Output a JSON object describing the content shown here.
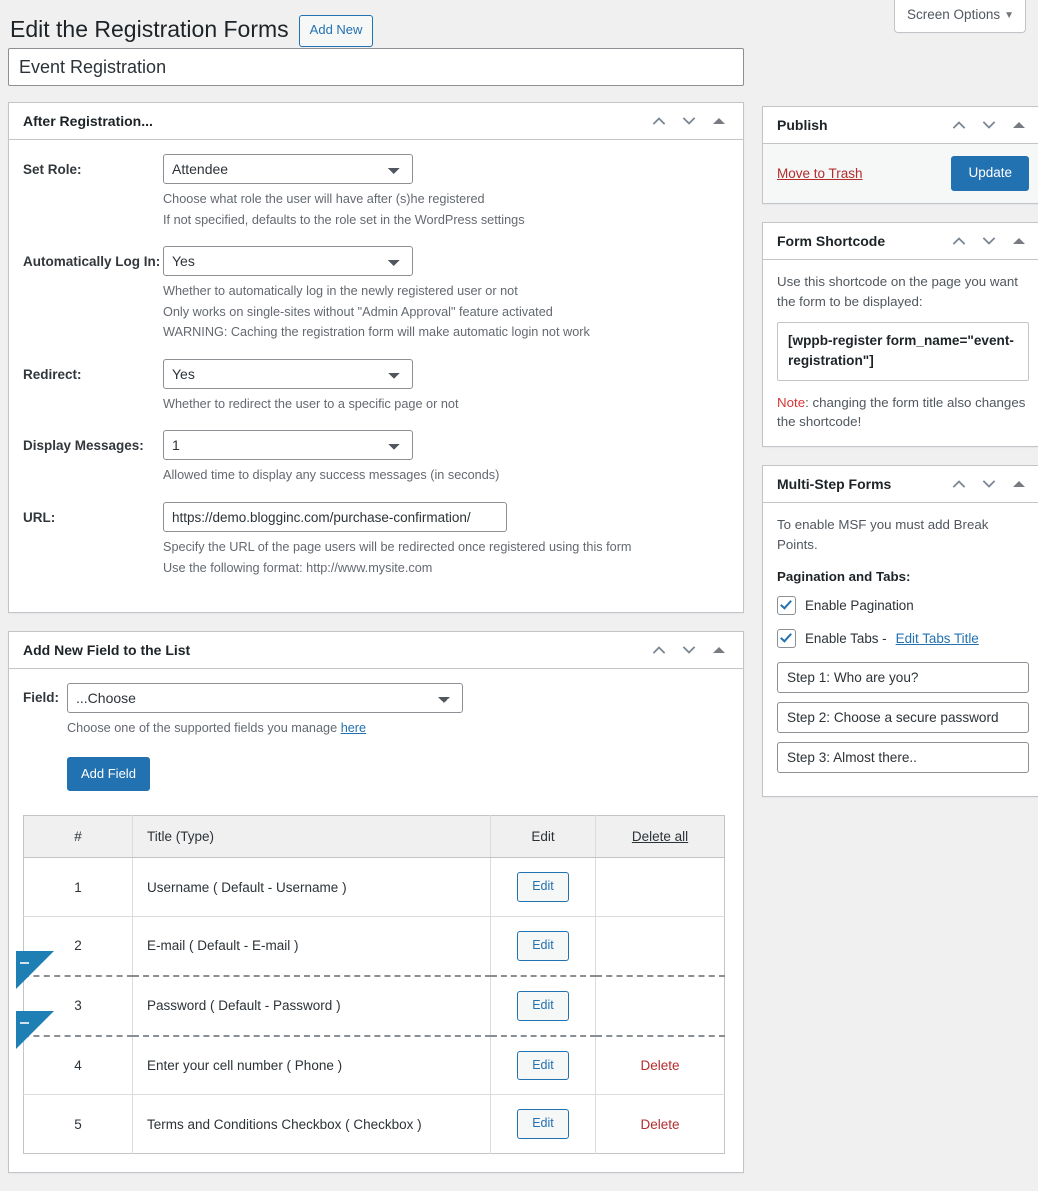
{
  "screen_options": {
    "label": "Screen Options",
    "caret": "chevron-down-icon"
  },
  "header": {
    "title": "Edit the Registration Forms",
    "add_new_label": "Add New"
  },
  "form_title": {
    "value": "Event Registration"
  },
  "panels": {
    "after_registration": {
      "title": "After Registration...",
      "rows": {
        "set_role": {
          "label": "Set Role:",
          "value": "Attendee",
          "hints": [
            "Choose what role the user will have after (s)he registered",
            "If not specified, defaults to the role set in the WordPress settings"
          ]
        },
        "auto_login": {
          "label": "Automatically Log In:",
          "value": "Yes",
          "hints": [
            "Whether to automatically log in the newly registered user or not",
            "Only works on single-sites without \"Admin Approval\" feature activated",
            "WARNING: Caching the registration form will make automatic login not work"
          ]
        },
        "redirect": {
          "label": "Redirect:",
          "value": "Yes",
          "hints": [
            "Whether to redirect the user to a specific page or not"
          ]
        },
        "display_messages": {
          "label": "Display Messages:",
          "value": "1",
          "hints": [
            "Allowed time to display any success messages (in seconds)"
          ]
        },
        "url": {
          "label": "URL:",
          "value": "https://demo.blogginc.com/purchase-confirmation/",
          "hints": [
            "Specify the URL of the page users will be redirected once registered using this form",
            "Use the following format: http://www.mysite.com"
          ]
        }
      }
    },
    "add_new_field": {
      "title": "Add New Field to the List",
      "field_label": "Field:",
      "field_value": "...Choose",
      "hint_prefix": "Choose one of the supported fields you manage ",
      "hint_link": "here",
      "add_field_label": "Add Field",
      "table": {
        "headers": [
          "#",
          "Title (Type)",
          "Edit",
          "Delete all"
        ],
        "rows": [
          {
            "num": "1",
            "title": "Username ( Default - Username )",
            "edit": "Edit",
            "delete": "",
            "breakpoint": false
          },
          {
            "num": "2",
            "title": "E-mail ( Default - E-mail )",
            "edit": "Edit",
            "delete": "",
            "breakpoint": true
          },
          {
            "num": "3",
            "title": "Password ( Default - Password )",
            "edit": "Edit",
            "delete": "",
            "breakpoint": true
          },
          {
            "num": "4",
            "title": "Enter your cell number ( Phone )",
            "edit": "Edit",
            "delete": "Delete",
            "breakpoint": false
          },
          {
            "num": "5",
            "title": "Terms and Conditions Checkbox ( Checkbox )",
            "edit": "Edit",
            "delete": "Delete",
            "breakpoint": false
          }
        ]
      }
    }
  },
  "sidebar": {
    "publish": {
      "title": "Publish",
      "trash_label": "Move to Trash",
      "update_label": "Update"
    },
    "shortcode": {
      "title": "Form Shortcode",
      "description": "Use this shortcode on the page you want the form to be displayed:",
      "code": "[wppb-register form_name=\"event-registration\"]",
      "note_key": "Note",
      "note_rest": ": changing the form title also changes the shortcode!"
    },
    "multistep": {
      "title": "Multi-Step Forms",
      "description": "To enable MSF you must add Break Points.",
      "subhead": "Pagination and Tabs:",
      "enable_pagination": "Enable Pagination",
      "enable_tabs": "Enable Tabs - ",
      "edit_tabs_title": "Edit Tabs Title",
      "steps": [
        "Step 1: Who are you?",
        "Step 2: Choose a secure password",
        "Step 3: Almost there.."
      ]
    }
  },
  "colors": {
    "accent": "#2271b1",
    "danger": "#b32d2e",
    "note": "#d63638",
    "breakpoint": "#1d7fb3"
  }
}
